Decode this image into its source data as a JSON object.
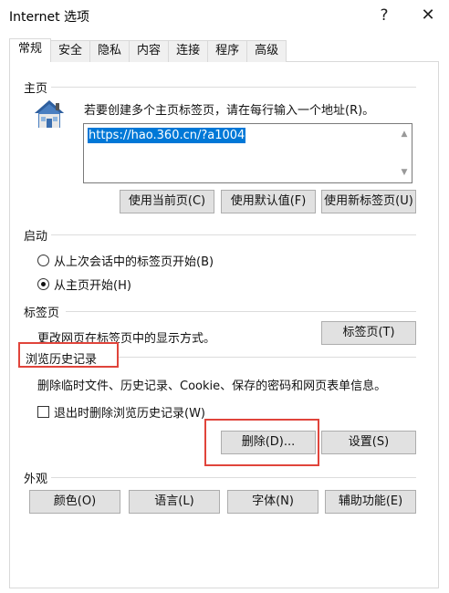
{
  "window": {
    "title": "Internet 选项",
    "help_glyph": "?",
    "close_glyph": "✕"
  },
  "tabs": [
    {
      "label": "常规",
      "active": true
    },
    {
      "label": "安全"
    },
    {
      "label": "隐私"
    },
    {
      "label": "内容"
    },
    {
      "label": "连接"
    },
    {
      "label": "程序"
    },
    {
      "label": "高级"
    }
  ],
  "home": {
    "section": "主页",
    "icon": "house-icon",
    "description": "若要创建多个主页标签页，请在每行输入一个地址(R)。",
    "url": "https://hao.360.cn/?a1004",
    "buttons": {
      "use_current": "使用当前页(C)",
      "use_default": "使用默认值(F)",
      "use_new_tab": "使用新标签页(U)"
    }
  },
  "startup": {
    "section": "启动",
    "option_last_session": "从上次会话中的标签页开始(B)",
    "option_home": "从主页开始(H)"
  },
  "tabs_section": {
    "section": "标签页",
    "description": "更改网页在标签页中的显示方式。",
    "button": "标签页(T)"
  },
  "history": {
    "section": "浏览历史记录",
    "description": "删除临时文件、历史记录、Cookie、保存的密码和网页表单信息。",
    "delete_on_exit": "退出时删除浏览历史记录(W)",
    "delete_button": "删除(D)...",
    "settings_button": "设置(S)"
  },
  "appearance": {
    "section": "外观",
    "colors": "颜色(O)",
    "languages": "语言(L)",
    "fonts": "字体(N)",
    "accessibility": "辅助功能(E)"
  },
  "colors": {
    "highlight": "#0078d7",
    "annotation_red": "#e0443b",
    "button_bg": "#e1e1e1"
  }
}
